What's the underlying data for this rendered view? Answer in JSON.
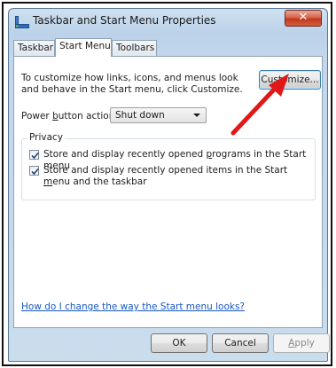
{
  "window": {
    "title": "Taskbar and Start Menu Properties",
    "close_glyph": "✕"
  },
  "tabs": [
    {
      "label": "Taskbar",
      "active": false
    },
    {
      "label": "Start Menu",
      "active": true
    },
    {
      "label": "Toolbars",
      "active": false
    }
  ],
  "start_menu": {
    "description": "To customize how links, icons, and menus look and behave in the Start menu, click Customize.",
    "customize_label": "Customize...",
    "power_label_pre": "Power ",
    "power_label_key": "b",
    "power_label_post": "utton action:",
    "power_value": "Shut down",
    "privacy_title": "Privacy",
    "privacy_items": [
      {
        "pre": "Store and display recently opened ",
        "key": "p",
        "post": "rograms in the Start menu",
        "checked": true
      },
      {
        "pre": "Store and display recently opened items in the Start ",
        "key": "m",
        "post": "enu and the taskbar",
        "checked": true
      }
    ],
    "help_link": "How do I change the way the Start menu looks?"
  },
  "footer": {
    "ok_label": "OK",
    "cancel_label": "Cancel",
    "apply_label": "Apply",
    "apply_key": "A",
    "apply_rest": "pply"
  },
  "icons": {
    "title_icon": "taskbar-icon",
    "select_arrow": "chevron-down-icon",
    "check": "checkmark-icon",
    "annotation": "red-arrow"
  },
  "colors": {
    "link": "#1658c4",
    "close_button": "#c2381c",
    "annotation_arrow": "#e01818"
  }
}
